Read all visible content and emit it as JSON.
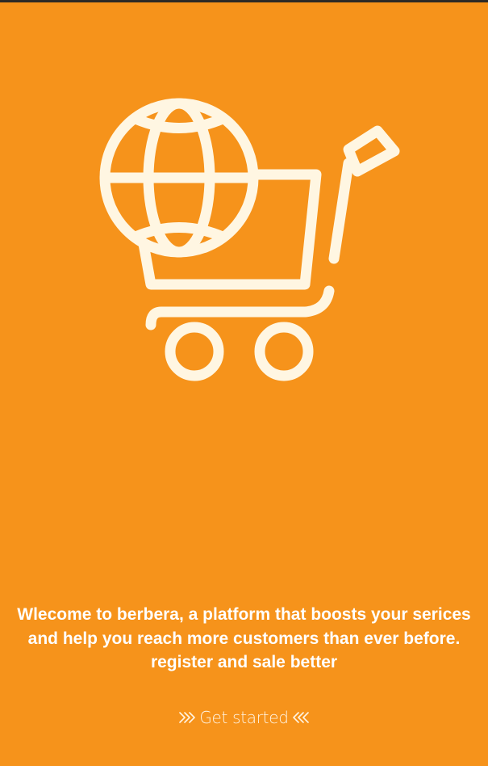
{
  "theme": {
    "background": "#f6931b",
    "icon_color": "#fff6e2",
    "text_color": "#ffffff"
  },
  "hero": {
    "icon": "shopping-cart-globe-icon"
  },
  "welcome": {
    "message": "Wlecome to berbera, a platform that boosts your serices and help you reach more customers than ever before. register and sale better"
  },
  "cta": {
    "label": "Get started",
    "left_icon": "double-chevron-right-icon",
    "right_icon": "double-chevron-left-icon"
  }
}
